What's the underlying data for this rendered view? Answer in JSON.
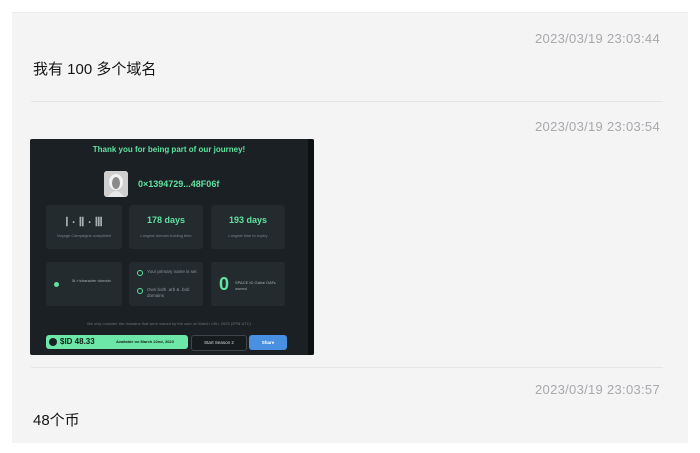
{
  "messages": [
    {
      "timestamp": "2023/03/19 23:03:44",
      "text": "我有 100 多个域名"
    },
    {
      "timestamp": "2023/03/19 23:03:54",
      "image": {
        "title": "Thank you for being part of our journey!",
        "address": "0×1394729...48F06f",
        "tiles": [
          {
            "value": "Ⅰ · Ⅱ · Ⅲ",
            "label": "Voyage Campaigns completed"
          },
          {
            "value": "178 days",
            "label": "Longest domain holding time"
          },
          {
            "value": "193 days",
            "label": "Longest time to expiry"
          }
        ],
        "char_domain": "5L+/character domain",
        "checks": [
          "Your primary name is set",
          "Own both .arb & .bnb domains"
        ],
        "gifts": {
          "count": "0",
          "label": "SPACE ID Galxe OATs owned"
        },
        "note": "We only consider the domains that were owned by the user on March 14th, 2023 (2PM UTC)",
        "amount": "$ID 48.33",
        "available": "Available on March 22nd, 2023",
        "season_button": "Start Season 2",
        "share_button": "Share"
      }
    },
    {
      "timestamp": "2023/03/19 23:03:57",
      "text": "48个币"
    }
  ]
}
